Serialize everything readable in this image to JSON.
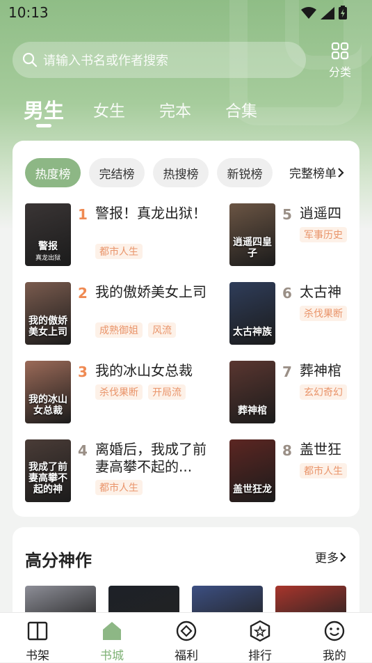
{
  "status_bar": {
    "time": "10:13"
  },
  "search": {
    "placeholder": "请输入书名或作者搜索"
  },
  "category_button": {
    "label": "分类"
  },
  "tabs": [
    {
      "label": "男生",
      "active": true
    },
    {
      "label": "女生"
    },
    {
      "label": "完本"
    },
    {
      "label": "合集"
    }
  ],
  "rank_chips": [
    {
      "label": "热度榜",
      "active": true
    },
    {
      "label": "完结榜"
    },
    {
      "label": "热搜榜"
    },
    {
      "label": "新锐榜"
    }
  ],
  "full_list_label": "完整榜单",
  "ranking": [
    {
      "rank": "1",
      "title": "警报！真龙出狱！",
      "tags": [
        "都市人生"
      ],
      "cover_text": "警报",
      "cover_sub": "真龙出狱",
      "cover_color": "#3a3535"
    },
    {
      "rank": "2",
      "title": "我的傲娇美女上司",
      "tags": [
        "成熟御姐",
        "风流"
      ],
      "cover_text": "我的傲娇美女上司",
      "cover_sub": "",
      "cover_color": "#7a5b4e"
    },
    {
      "rank": "3",
      "title": "我的冰山女总裁",
      "tags": [
        "杀伐果断",
        "开局流"
      ],
      "cover_text": "我的冰山女总裁",
      "cover_sub": "",
      "cover_color": "#9b6a58"
    },
    {
      "rank": "4",
      "title": "离婚后，我成了前妻高攀不起的...",
      "tags": [
        "都市人生"
      ],
      "cover_text": "我成了前妻高攀不起的神",
      "cover_sub": "",
      "cover_color": "#4a3c37"
    },
    {
      "rank": "5",
      "title": "逍遥四",
      "tags": [
        "军事历史"
      ],
      "cover_text": "逍遥四皇子",
      "cover_sub": "",
      "cover_color": "#6b5544"
    },
    {
      "rank": "6",
      "title": "太古神",
      "tags": [
        "杀伐果断"
      ],
      "cover_text": "太古神族",
      "cover_sub": "",
      "cover_color": "#2f3d5a"
    },
    {
      "rank": "7",
      "title": "葬神棺",
      "tags": [
        "玄幻奇幻"
      ],
      "cover_text": "葬神棺",
      "cover_sub": "",
      "cover_color": "#5a3630"
    },
    {
      "rank": "8",
      "title": "盖世狂",
      "tags": [
        "都市人生"
      ],
      "cover_text": "盖世狂龙",
      "cover_sub": "",
      "cover_color": "#5c2622"
    }
  ],
  "high_score": {
    "title": "高分神作",
    "more": "更多"
  },
  "high_score_covers": [
    "#8d8e97",
    "#1d2128",
    "#3c4f82",
    "#a8352c"
  ],
  "rank_colors": {
    "top": "#ef8a53",
    "rest": "#9a8f86"
  },
  "bottom_nav": [
    {
      "label": "书架",
      "icon": "book-icon"
    },
    {
      "label": "书城",
      "icon": "home-icon",
      "active": true
    },
    {
      "label": "福利",
      "icon": "gift-icon"
    },
    {
      "label": "排行",
      "icon": "rank-icon"
    },
    {
      "label": "我的",
      "icon": "smile-icon"
    }
  ],
  "accent": "#8db785"
}
